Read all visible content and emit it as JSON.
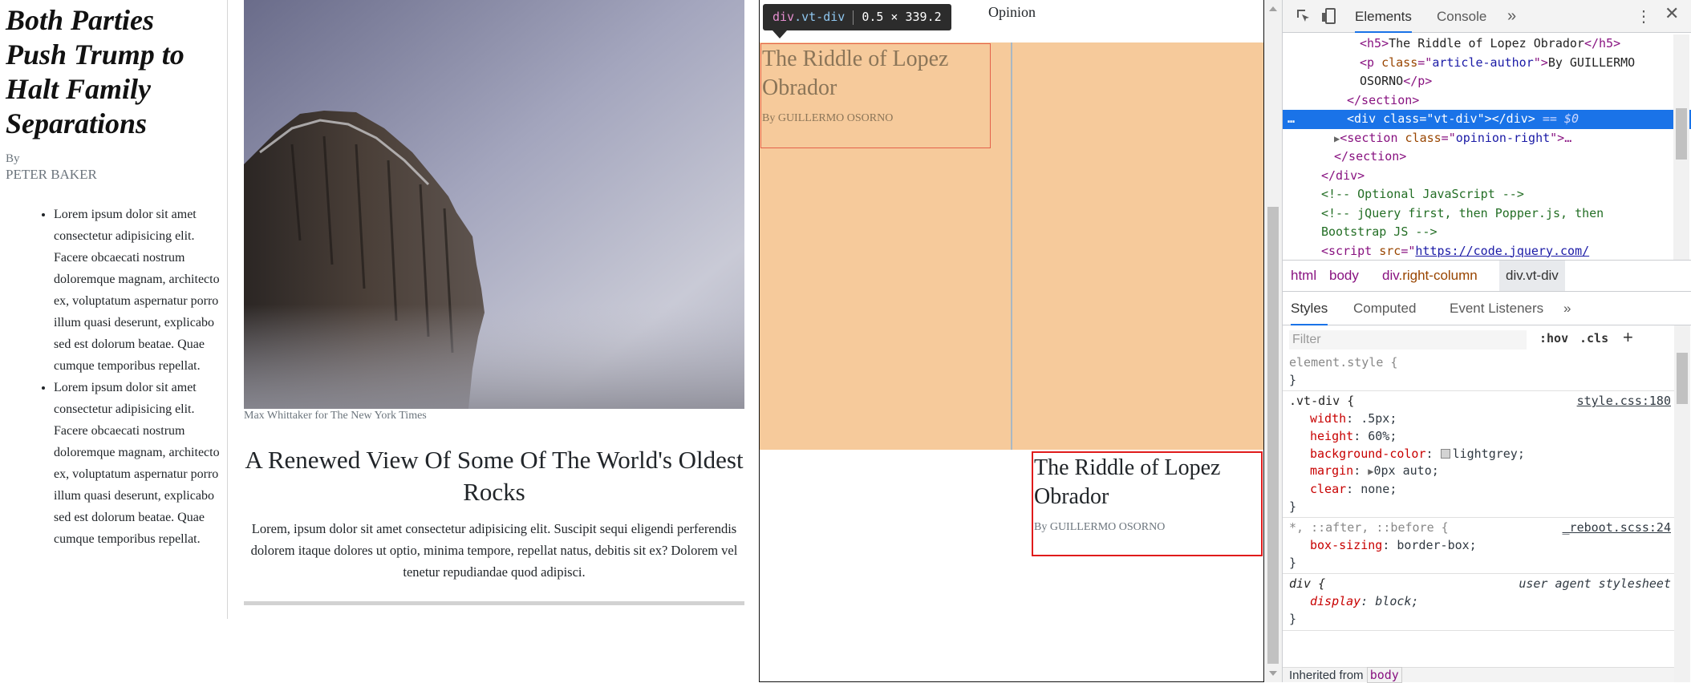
{
  "article": {
    "headline": "Both Parties Push Trump to Halt Family Separations",
    "byline_label": "By",
    "author": "PETER BAKER",
    "bullets": [
      "Lorem ipsum dolor sit amet consectetur adipisicing elit. Facere obcaecati nostrum doloremque magnam, architecto ex, voluptatum aspernatur porro illum quasi deserunt, explicabo sed est dolorum beatae. Quae cumque temporibus repellat.",
      "Lorem ipsum dolor sit amet consectetur adipisicing elit. Facere obcaecati nostrum doloremque magnam, architecto ex, voluptatum aspernatur porro illum quasi deserunt, explicabo sed est dolorum beatae. Quae cumque temporibus repellat."
    ]
  },
  "feature": {
    "caption": "Max Whittaker for The New York Times",
    "title": "A Renewed View Of Some Of The World's Oldest Rocks",
    "summary": "Lorem, ipsum dolor sit amet consectetur adipisicing elit. Suscipit sequi eligendi perferendis dolorem itaque dolores ut optio, minima tempore, repellat natus, debitis sit ex? Dolorem vel tenetur repudiandae quod adipisci."
  },
  "opinion": {
    "label": "Opinion",
    "tooltip": {
      "tag": "div",
      "cls": ".vt-div",
      "size": "0.5 × 339.2"
    },
    "cards": [
      {
        "title": "The Riddle of Lopez Obrador",
        "author": "By GUILLERMO OSORNO"
      },
      {
        "title": "The Riddle of Lopez Obrador",
        "author": "By GUILLERMO OSORNO"
      }
    ]
  },
  "devtools": {
    "tabs": {
      "elements": "Elements",
      "console": "Console",
      "more": "»"
    },
    "dom": {
      "l1_open": "<h5>",
      "l1_text": "The Riddle of Lopez Obrador",
      "l1_close": "</h5>",
      "l2_open": "<p ",
      "l2_attr": "class",
      "l2_eq": "=\"",
      "l2_val": "article-author",
      "l2_end": "\">",
      "l2_text": "By GUILLERMO",
      "l3_text": "OSORNO",
      "l3_close": "</p>",
      "l4": "</section>",
      "l5_open": "<div ",
      "l5_attr": "class",
      "l5_eq": "=\"",
      "l5_val": "vt-div",
      "l5_end": "\"></div>",
      "l5_marker": " == $0",
      "l6_open": "<section ",
      "l6_attr": "class",
      "l6_eq": "=\"",
      "l6_val": "opinion-right",
      "l6_end": "\">…",
      "l7": "</section>",
      "l8": "</div>",
      "l9": "<!-- Optional JavaScript -->",
      "l10": "<!-- jQuery first, then Popper.js, then",
      "l11": "Bootstrap JS -->",
      "l12_open": "<script ",
      "l12_attr": "src",
      "l12_eq": "=\"",
      "l12_link": "https://code.jquery.com/"
    },
    "breadcrumbs": {
      "html": "html",
      "body": "body",
      "right_tag": "div",
      "right_cls": ".right-column",
      "vt": "div.vt-div"
    },
    "styles_tabs": {
      "styles": "Styles",
      "computed": "Computed",
      "listeners": "Event Listeners",
      "more": "»"
    },
    "filter_placeholder": "Filter",
    "hov": ":hov",
    "cls": ".cls",
    "plus": "+",
    "rules": {
      "element_style": "element.style {",
      "close": "}",
      "vt_selector": ".vt-div {",
      "vt_source": "style.css:180",
      "width_prop": "width",
      "width_val": ".5px;",
      "height_prop": "height",
      "height_val": "60%;",
      "bg_prop": "background-color",
      "bg_val": "lightgrey;",
      "margin_prop": "margin",
      "margin_val": "0px auto;",
      "clear_prop": "clear",
      "clear_val": "none;",
      "star_selector": "*, ::after, ::before {",
      "star_source": "_reboot.scss:24",
      "box_prop": "box-sizing",
      "box_val": "border-box;",
      "div_selector": "div {",
      "div_source": "user agent stylesheet",
      "display_prop": "display",
      "display_val": "block;",
      "colon": ": "
    },
    "inherited_label": "Inherited from",
    "inherited_tag": "body"
  }
}
